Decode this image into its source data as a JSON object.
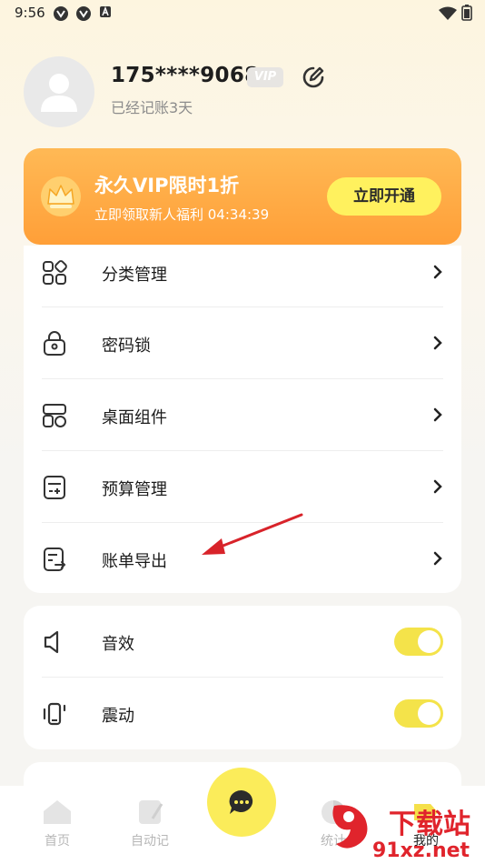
{
  "status_bar": {
    "time": "9:56"
  },
  "profile": {
    "phone": "175****9068",
    "vip_tag": "VIP",
    "days_text": "已经记账3天"
  },
  "banner": {
    "title": "永久VIP限时1折",
    "subtitle": "立即领取新人福利 04:34:39",
    "button": "立即开通"
  },
  "menu": {
    "items": [
      {
        "label": "分类管理",
        "icon": "category-icon"
      },
      {
        "label": "密码锁",
        "icon": "lock-icon"
      },
      {
        "label": "桌面组件",
        "icon": "widget-icon"
      },
      {
        "label": "预算管理",
        "icon": "budget-icon"
      },
      {
        "label": "账单导出",
        "icon": "export-icon"
      }
    ]
  },
  "settings": {
    "items": [
      {
        "label": "音效",
        "icon": "speaker-icon",
        "enabled": true
      },
      {
        "label": "震动",
        "icon": "vibrate-icon",
        "enabled": true
      }
    ]
  },
  "bottom_nav": {
    "items": [
      {
        "label": "首页",
        "icon": "home-icon"
      },
      {
        "label": "自动记",
        "icon": "auto-record-icon"
      },
      {
        "label": "统计",
        "icon": "stats-icon"
      },
      {
        "label": "我的",
        "icon": "profile-icon"
      }
    ]
  },
  "watermark": {
    "line1": "下载站",
    "line2": "91xz.net"
  },
  "colors": {
    "accent_yellow": "#fbec5a",
    "banner_orange": "#ffa43e",
    "annotation_red": "#d8232a"
  }
}
